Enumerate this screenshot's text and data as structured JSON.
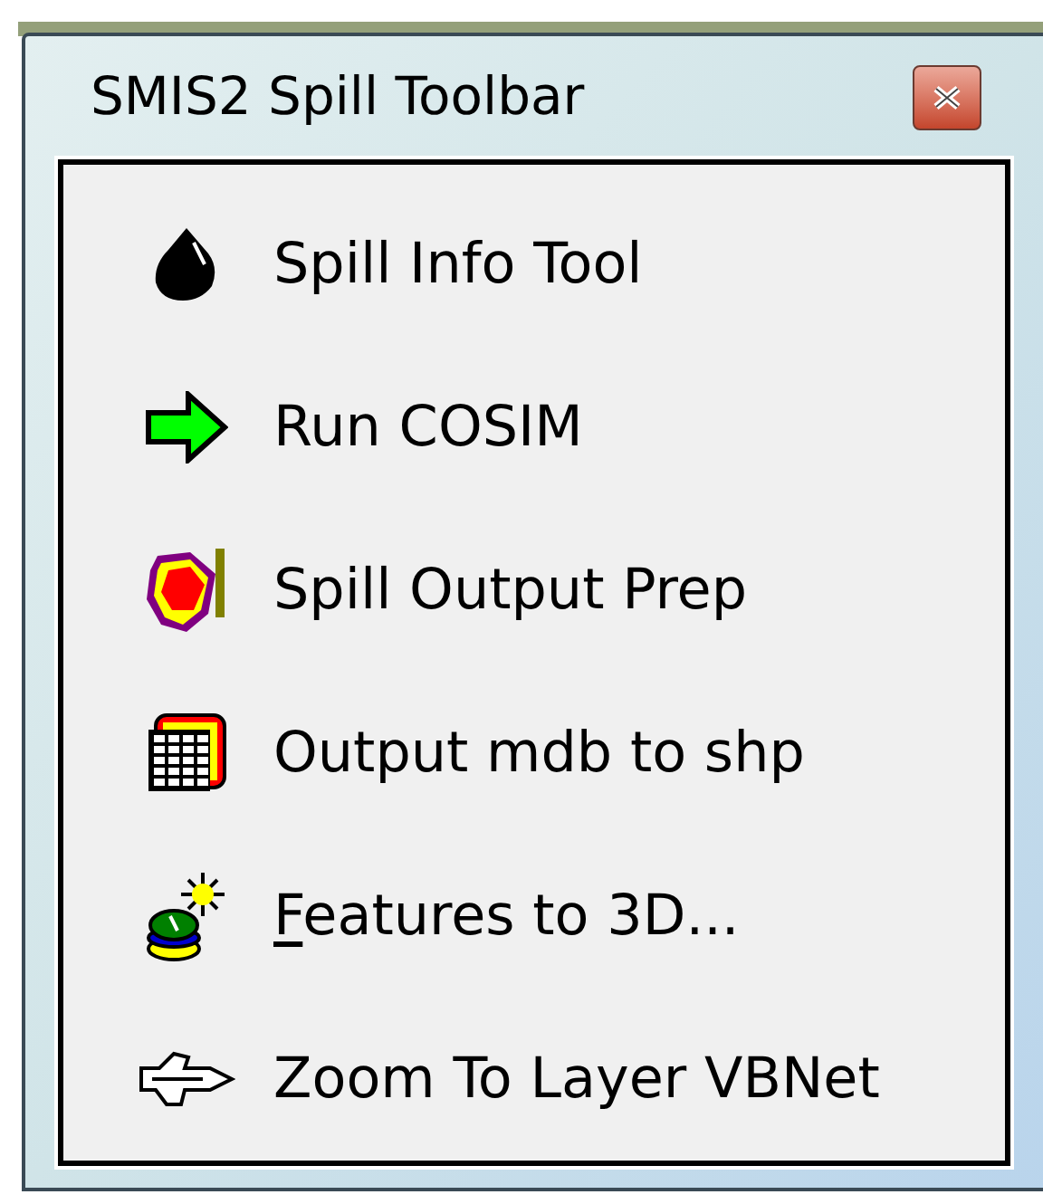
{
  "window": {
    "title": "SMIS2 Spill Toolbar"
  },
  "tools": [
    {
      "kind": "drop",
      "label": "Spill Info Tool",
      "mnemonic": false
    },
    {
      "kind": "arrow",
      "label": "Run COSIM",
      "mnemonic": false
    },
    {
      "kind": "blob",
      "label": "Spill Output Prep",
      "mnemonic": false
    },
    {
      "kind": "grid",
      "label": "Output mdb to shp",
      "mnemonic": false
    },
    {
      "kind": "layers",
      "label": "Features to 3D...",
      "mnemonic": true
    },
    {
      "kind": "plane",
      "label": "Zoom To Layer VBNet",
      "mnemonic": false
    }
  ]
}
